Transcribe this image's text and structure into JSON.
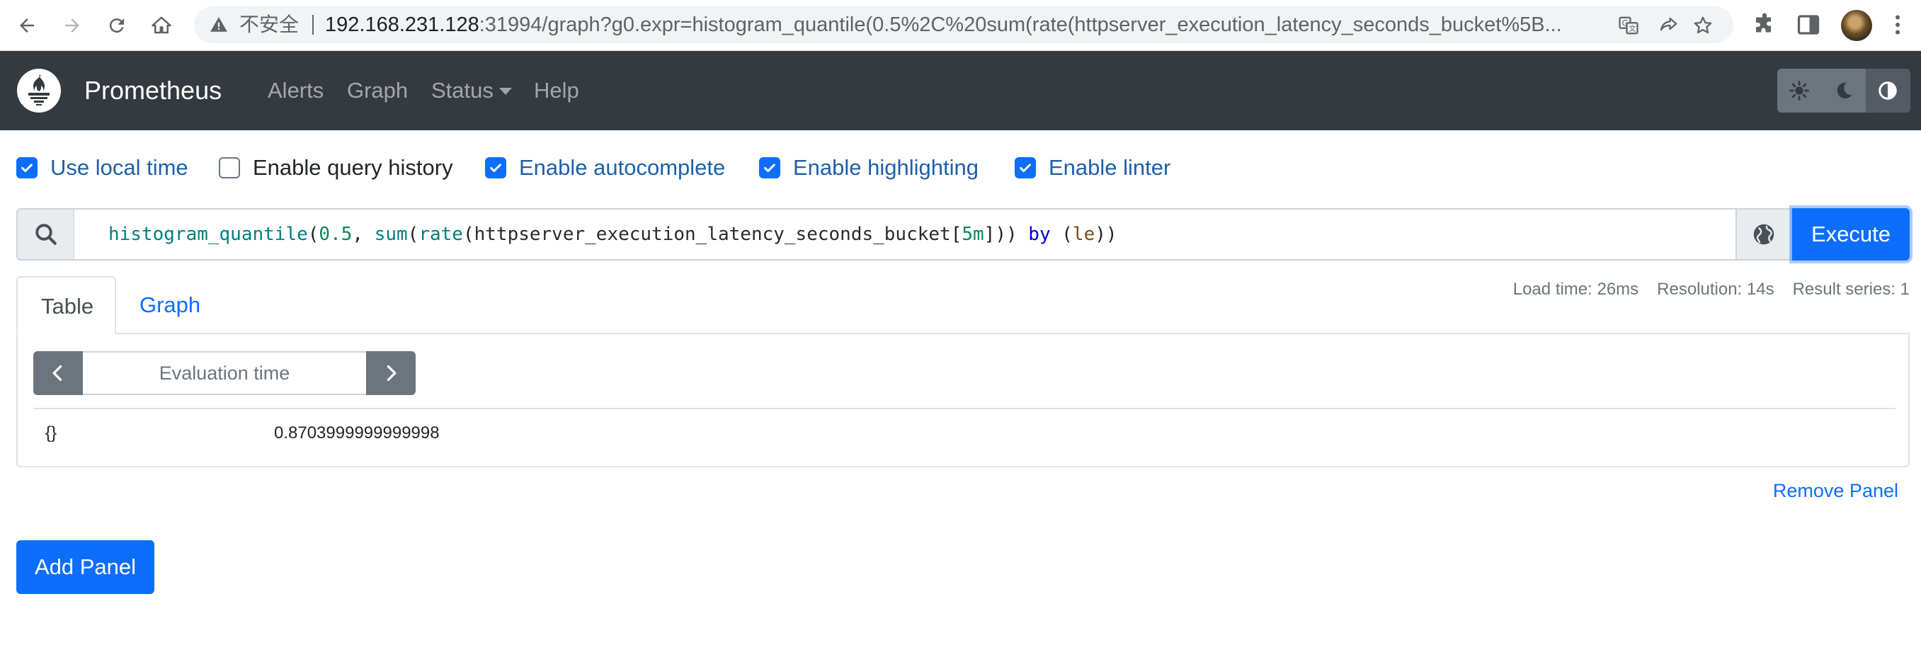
{
  "browser": {
    "security_label": "不安全",
    "url_host": "192.168.231.128",
    "url_rest": ":31994/graph?g0.expr=histogram_quantile(0.5%2C%20sum(rate(httpserver_execution_latency_seconds_bucket%5B..."
  },
  "navbar": {
    "brand": "Prometheus",
    "links": [
      "Alerts",
      "Graph",
      "Status",
      "Help"
    ],
    "status_has_dropdown": true
  },
  "options": [
    {
      "label": "Use local time",
      "checked": true
    },
    {
      "label": "Enable query history",
      "checked": false
    },
    {
      "label": "Enable autocomplete",
      "checked": true
    },
    {
      "label": "Enable highlighting",
      "checked": true
    },
    {
      "label": "Enable linter",
      "checked": true
    }
  ],
  "expression": {
    "tokens": [
      {
        "t": "histogram_quantile",
        "c": "fn"
      },
      {
        "t": "(",
        "c": "p"
      },
      {
        "t": "0.5",
        "c": "num"
      },
      {
        "t": ", ",
        "c": "p"
      },
      {
        "t": "sum",
        "c": "fn"
      },
      {
        "t": "(",
        "c": "p"
      },
      {
        "t": "rate",
        "c": "fn"
      },
      {
        "t": "(",
        "c": "p"
      },
      {
        "t": "httpserver_execution_latency_seconds_bucket",
        "c": "metric"
      },
      {
        "t": "[",
        "c": "p"
      },
      {
        "t": "5m",
        "c": "dur"
      },
      {
        "t": "])) ",
        "c": "p"
      },
      {
        "t": "by",
        "c": "kw"
      },
      {
        "t": " (",
        "c": "p"
      },
      {
        "t": "le",
        "c": "lbl"
      },
      {
        "t": "))",
        "c": "p"
      }
    ],
    "execute_label": "Execute"
  },
  "panel": {
    "tabs": [
      "Table",
      "Graph"
    ],
    "active_tab": "Table",
    "stats": {
      "load_time": "Load time: 26ms",
      "resolution": "Resolution: 14s",
      "result_series": "Result series: 1"
    },
    "eval_placeholder": "Evaluation time",
    "results": [
      {
        "labels": "{}",
        "value": "0.8703999999999998"
      }
    ],
    "remove_label": "Remove Panel"
  },
  "add_panel_label": "Add Panel",
  "colors": {
    "navbar_bg": "#343a40",
    "primary": "#0d6efd",
    "secondary": "#6c757d"
  }
}
